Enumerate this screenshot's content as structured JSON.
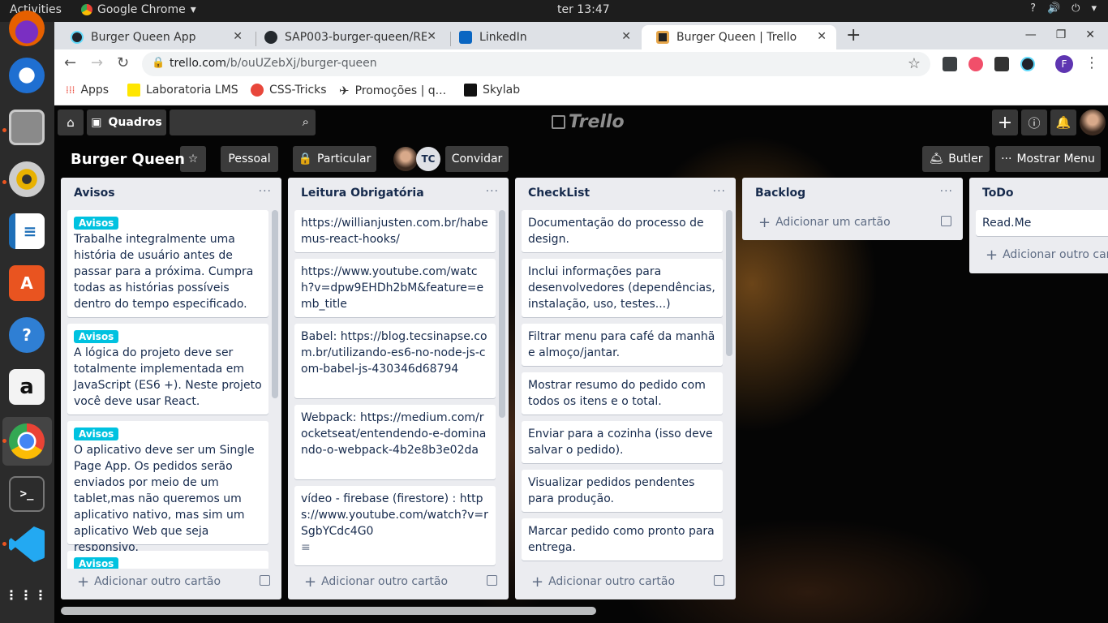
{
  "system": {
    "activities": "Activities",
    "app_name": "Google Chrome",
    "clock": "ter 13:47",
    "tray": [
      "?",
      "🔊",
      "⏻",
      "▾"
    ]
  },
  "dock": {
    "apps": [
      "firefox-icon",
      "thunderbird-icon",
      "files-icon",
      "rhythmbox-icon",
      "writer-icon",
      "software-icon",
      "help-icon",
      "amazon-icon",
      "chrome-icon",
      "terminal-icon",
      "vscode-icon",
      "apps-grid-icon"
    ]
  },
  "browser": {
    "tabs": [
      {
        "label": "Burger Queen App",
        "icon_color": "#20232a"
      },
      {
        "label": "SAP003-burger-queen/RE",
        "icon_color": "#24292e"
      },
      {
        "label": "LinkedIn",
        "icon_color": "#0a66c2"
      },
      {
        "label": "Burger Queen | Trello",
        "icon_color": "#0079bf"
      }
    ],
    "new_tab": "+",
    "url_host": "trello.com",
    "url_path": "/b/ouUZebXj/burger-queen",
    "profile_initial": "F",
    "bookmarks": [
      {
        "label": "Apps",
        "color": "#ea4335"
      },
      {
        "label": "Laboratoria LMS",
        "color": "#ffe600"
      },
      {
        "label": "CSS-Tricks",
        "color": "#e8473b"
      },
      {
        "label": "Promoções | q...",
        "color": "#222222"
      },
      {
        "label": "Skylab",
        "color": "#111111"
      }
    ]
  },
  "trello": {
    "boards_label": "Quadros",
    "search_placeholder": "",
    "logo": "Trello",
    "board_title": "Burger Queen",
    "team": "Pessoal",
    "visibility": "Particular",
    "member_initials": "TC",
    "invite": "Convidar",
    "butler": "Butler",
    "show_menu": "Mostrar Menu",
    "label_color": "#00c2e0",
    "lists": [
      {
        "title": "Avisos",
        "footer": "Adicionar outro cartão",
        "cards": [
          {
            "label": "Avisos",
            "text": "Trabalhe integralmente uma história de usuário antes de passar para a próxima. Cumpra todas as histórias possíveis dentro do tempo especificado."
          },
          {
            "label": "Avisos",
            "text": "A lógica do projeto deve ser totalmente implementada em JavaScript (ES6 +). Neste projeto você deve usar React."
          },
          {
            "label": "Avisos",
            "text": "O aplicativo deve ser um Single Page App. Os pedidos serão enviados por meio de um tablet,mas não queremos um aplicativo nativo, mas sim um aplicativo Web que seja responsivo."
          },
          {
            "label": "Avisos",
            "text": ""
          }
        ]
      },
      {
        "title": "Leitura Obrigatória",
        "footer": "Adicionar outro cartão",
        "cards": [
          {
            "text": "https://willianjusten.com.br/habemus-react-hooks/"
          },
          {
            "text": "https://www.youtube.com/watch?v=dpw9EHDh2bM&feature=emb_title"
          },
          {
            "text": "Babel: https://blog.tecsinapse.com.br/utilizando-es6-no-node-js-com-babel-js-430346d68794"
          },
          {
            "text": "Webpack: https://medium.com/rocketseat/entendendo-e-dominando-o-webpack-4b2e8b3e02da"
          },
          {
            "text": "vídeo - firebase (firestore) : https://www.youtube.com/watch?v=rSgbYCdc4G0",
            "desc_icon": "≡"
          }
        ]
      },
      {
        "title": "CheckList",
        "footer": "Adicionar outro cartão",
        "cards": [
          {
            "text": "Documentação do processo de design."
          },
          {
            "text": "Inclui informações para desenvolvedores (dependências, instalação, uso, testes...)"
          },
          {
            "text": "Filtrar menu para café da manhã e almoço/jantar."
          },
          {
            "text": "Mostrar resumo do pedido com todos os itens e o total."
          },
          {
            "text": "Enviar para a cozinha (isso deve salvar o pedido)."
          },
          {
            "text": "Visualizar pedidos pendentes para produção."
          },
          {
            "text": "Marcar pedido como pronto para entrega."
          }
        ]
      },
      {
        "title": "Backlog",
        "footer": "Adicionar um cartão",
        "cards": []
      },
      {
        "title": "ToDo",
        "footer": "Adicionar outro cartão",
        "cards": [
          {
            "text": "Read.Me"
          }
        ]
      }
    ]
  }
}
